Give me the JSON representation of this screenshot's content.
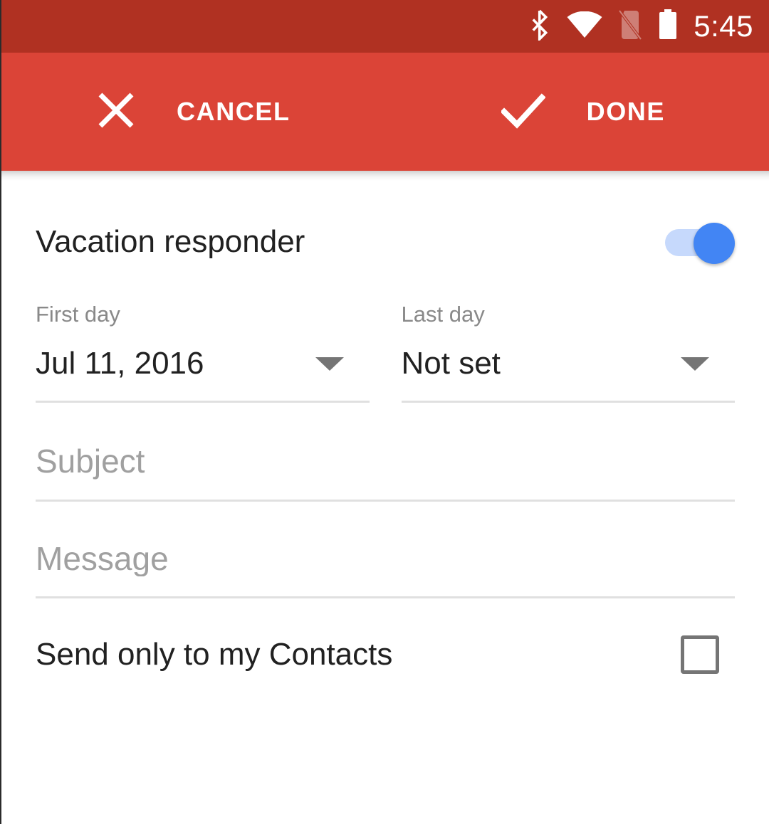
{
  "status_bar": {
    "background_color": "#b03122",
    "clock": "5:45",
    "icons": [
      {
        "name": "bluetooth-icon",
        "label": "Bluetooth"
      },
      {
        "name": "wifi-icon",
        "label": "Wi-Fi full signal"
      },
      {
        "name": "no-sim-card-icon",
        "label": "No SIM card"
      },
      {
        "name": "battery-full-icon",
        "label": "Battery full"
      }
    ]
  },
  "toolbar": {
    "background_color": "#db4437",
    "cancel_label": "CANCEL",
    "done_label": "DONE",
    "cancel_icon": "close-icon",
    "done_icon": "check-icon"
  },
  "main": {
    "responder": {
      "label": "Vacation responder",
      "toggle_state": "on",
      "toggle_thumb_color": "#4285f4",
      "toggle_track_color": "#c6d9fc"
    },
    "first_day": {
      "caption": "First day",
      "value": "Jul 11, 2016",
      "dropdown_icon": "chevron-down-icon"
    },
    "last_day": {
      "caption": "Last day",
      "value": "Not set",
      "dropdown_icon": "chevron-down-icon"
    },
    "subject": {
      "placeholder": "Subject",
      "value": ""
    },
    "message": {
      "placeholder": "Message",
      "value": ""
    },
    "contacts_only": {
      "label": "Send only to my Contacts",
      "checked": false
    }
  }
}
